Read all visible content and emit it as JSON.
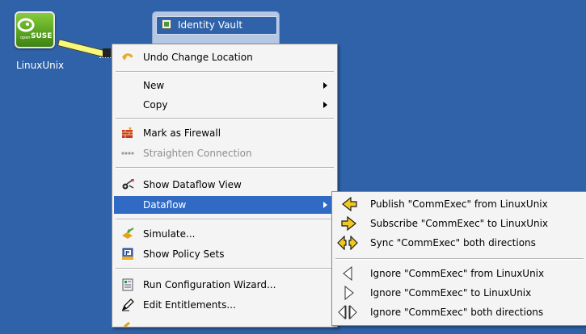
{
  "app_node": {
    "label": "LinuxUnix",
    "icon_brand": "open",
    "icon_text": "SUSE"
  },
  "vault": {
    "title": "Identity Vault"
  },
  "main_menu": {
    "undo": "Undo Change Location",
    "new": "New",
    "copy": "Copy",
    "mark_firewall": "Mark as Firewall",
    "straighten": "Straighten Connection",
    "show_dataflow": "Show Dataflow View",
    "dataflow": "Dataflow",
    "simulate": "Simulate...",
    "show_policy": "Show Policy Sets",
    "run_config": "Run Configuration Wizard...",
    "edit_entitlements": "Edit Entitlements..."
  },
  "dataflow_menu": {
    "publish": "Publish \"CommExec\" from LinuxUnix",
    "subscribe": "Subscribe \"CommExec\" to LinuxUnix",
    "sync": "Sync \"CommExec\" both directions",
    "ignore_from": "Ignore \"CommExec\" from LinuxUnix",
    "ignore_to": "Ignore \"CommExec\" to LinuxUnix",
    "ignore_both": "Ignore \"CommExec\" both directions"
  },
  "colors": {
    "desktop": "#2f62a8",
    "menu_bg": "#f4f4f4",
    "highlight": "#316ac5",
    "connector": "#f7f77a",
    "dataflow_arrow": "#f2c81e"
  }
}
